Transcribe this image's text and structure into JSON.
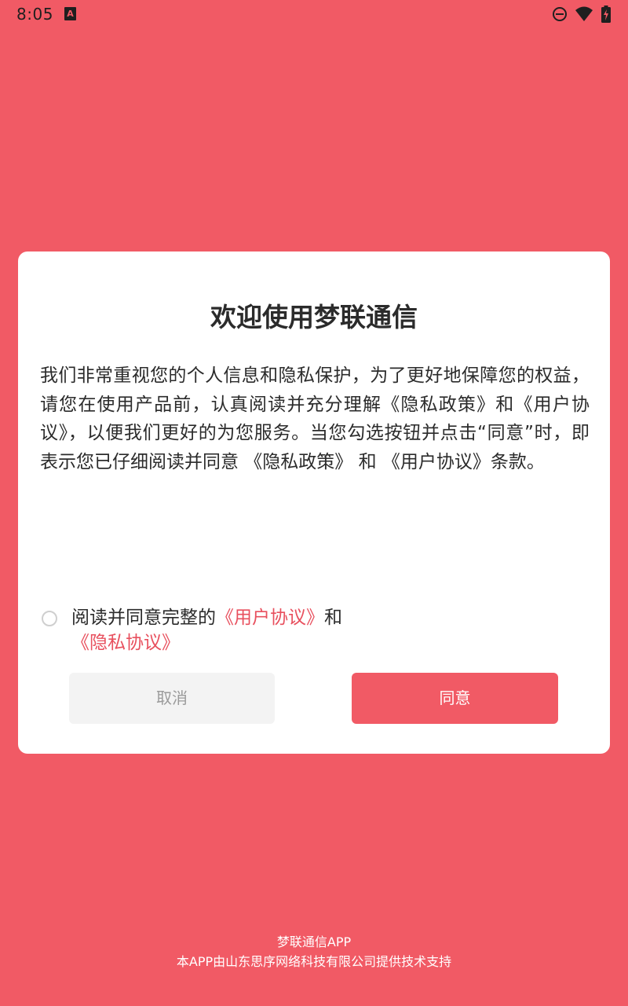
{
  "status_bar": {
    "time": "8:05",
    "app_icon": "A",
    "icons": [
      "dnd-icon",
      "wifi-icon",
      "battery-charging-icon"
    ]
  },
  "colors": {
    "background": "#F15A65",
    "accent": "#E8505E",
    "cancel_bg": "#F3F3F3",
    "cancel_text": "#9a9a9a"
  },
  "dialog": {
    "title": "欢迎使用梦联通信",
    "body": "我们非常重视您的个人信息和隐私保护，为了更好地保障您的权益，请您在使用产品前，认真阅读并充分理解《隐私政策》和《用户协议》，以便我们更好的为您服务。当您勾选按钮并点击“同意”时，即表示您已仔细阅读并同意 《隐私政策》 和 《用户协议》条款。",
    "agree": {
      "prefix": "阅读并同意完整的",
      "user_agreement_link": "《用户协议》",
      "conjunction": "和",
      "privacy_link": "《隐私协议》",
      "checked": false
    },
    "cancel_label": "取消",
    "agree_label": "同意"
  },
  "footer": {
    "app_name": "梦联通信APP",
    "support": "本APP由山东思序网络科技有限公司提供技术支持"
  }
}
